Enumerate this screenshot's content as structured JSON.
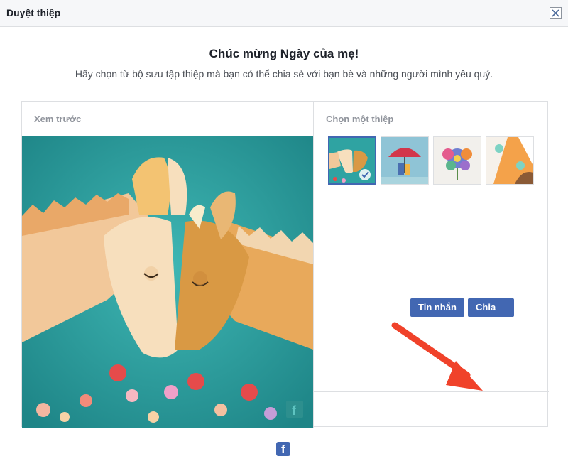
{
  "window": {
    "title": "Duyệt thiệp"
  },
  "header": {
    "heading": "Chúc mừng Ngày của mẹ!",
    "subheading": "Hãy chọn từ bộ sưu tập thiệp mà bạn có thể chia sẻ với bạn bè và những người mình yêu quý."
  },
  "preview": {
    "label": "Xem trước"
  },
  "chooser": {
    "label": "Chọn một thiệp",
    "thumbnails": [
      {
        "name": "horses-card",
        "selected": true
      },
      {
        "name": "umbrella-card",
        "selected": false
      },
      {
        "name": "flowers-card",
        "selected": false
      },
      {
        "name": "orange-card",
        "selected": false
      }
    ]
  },
  "actions": {
    "message_label": "Tin nhắn",
    "share_label": "Chia sẻ"
  },
  "colors": {
    "accent": "#4267b2",
    "teal_bg": "#2fa3a2",
    "arrow": "#f0422a"
  }
}
